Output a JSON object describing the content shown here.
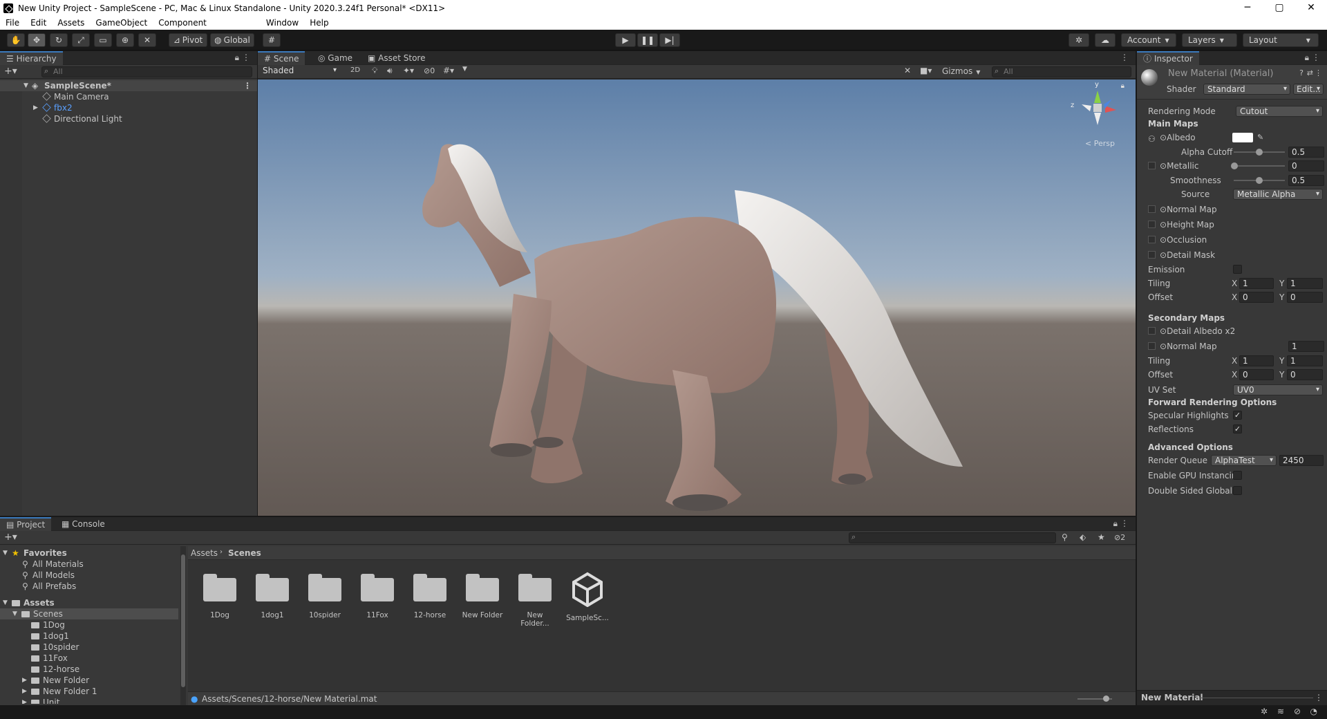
{
  "window": {
    "title": "New Unity Project - SampleScene - PC, Mac & Linux Standalone - Unity 2020.3.24f1 Personal* <DX11>",
    "min": "─",
    "max": "▢",
    "close": "✕"
  },
  "menu": [
    "File",
    "Edit",
    "Assets",
    "GameObject",
    "Component",
    "Window",
    "Help"
  ],
  "toolbar": {
    "pivot": "Pivot",
    "global": "Global",
    "account": "Account",
    "layers": "Layers",
    "layout": "Layout"
  },
  "hierarchy": {
    "tab": "Hierarchy",
    "search_placeholder": "All",
    "scene": "SampleScene*",
    "items": [
      "Main Camera",
      "fbx2",
      "Directional Light"
    ]
  },
  "scene_view": {
    "tabs": [
      "Scene",
      "Game",
      "Asset Store"
    ],
    "shading": "Shaded",
    "mode_2d": "2D",
    "hidden_count": "0",
    "gizmos": "Gizmos",
    "search_placeholder": "All",
    "persp": "< Persp",
    "axis_y": "y",
    "axis_z": "z",
    "sky_color": "#7d9cc0",
    "ground_color": "#6e6660",
    "horse_color": "#a98d83",
    "mane_color": "#e4e1df"
  },
  "inspector": {
    "tab": "Inspector",
    "material_name": "New Material (Material)",
    "shader_label": "Shader",
    "shader_value": "Standard",
    "edit_button": "Edit...",
    "rendering_mode_label": "Rendering Mode",
    "rendering_mode_value": "Cutout",
    "main_maps": "Main Maps",
    "albedo": "Albedo",
    "alpha_cutoff": "Alpha Cutoff",
    "alpha_cutoff_value": "0.5",
    "metallic": "Metallic",
    "metallic_value": "0",
    "smoothness": "Smoothness",
    "smoothness_value": "0.5",
    "source": "Source",
    "source_value": "Metallic Alpha",
    "normal_map": "Normal Map",
    "height_map": "Height Map",
    "occlusion": "Occlusion",
    "detail_mask": "Detail Mask",
    "emission": "Emission",
    "tiling": "Tiling",
    "offset": "Offset",
    "x": "X",
    "y": "Y",
    "tiling_x": "1",
    "tiling_y": "1",
    "offset_x": "0",
    "offset_y": "0",
    "secondary_maps": "Secondary Maps",
    "detail_albedo": "Detail Albedo x2",
    "sec_normal_map": "Normal Map",
    "sec_normal_value": "1",
    "sec_tiling_x": "1",
    "sec_tiling_y": "1",
    "sec_offset_x": "0",
    "sec_offset_y": "0",
    "uv_set": "UV Set",
    "uv_set_value": "UV0",
    "forward_options": "Forward Rendering Options",
    "specular_highlights": "Specular Highlights",
    "reflections": "Reflections",
    "advanced_options": "Advanced Options",
    "render_queue": "Render Queue",
    "render_queue_mode": "AlphaTest",
    "render_queue_value": "2450",
    "gpu_instancing": "Enable GPU Instancin",
    "double_sided": "Double Sided Global I",
    "footer": "New Material",
    "check": "✓"
  },
  "project": {
    "tabs": [
      "Project",
      "Console"
    ],
    "hidden_count": "2",
    "favorites": "Favorites",
    "favorite_items": [
      "All Materials",
      "All Models",
      "All Prefabs"
    ],
    "assets": "Assets",
    "scenes": "Scenes",
    "scene_folders": [
      "1Dog",
      "1dog1",
      "10spider",
      "11Fox",
      "12-horse",
      "New Folder",
      "New Folder 1",
      "Unit"
    ],
    "breadcrumb": [
      "Assets",
      "Scenes"
    ],
    "grid_items": [
      "1Dog",
      "1dog1",
      "10spider",
      "11Fox",
      "12-horse",
      "New Folder",
      "New Folder...",
      "SampleSc..."
    ],
    "path": "Assets/Scenes/12-horse/New Material.mat"
  }
}
